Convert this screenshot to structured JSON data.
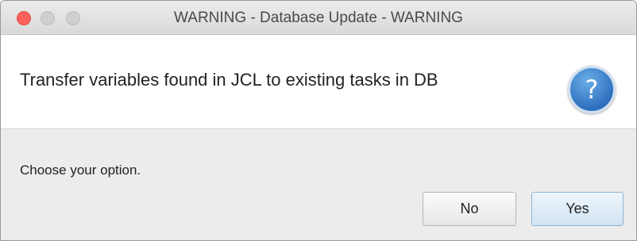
{
  "window": {
    "title": "WARNING - Database Update - WARNING"
  },
  "header": {
    "message": "Transfer variables found in JCL to existing tasks in DB",
    "icon": "question-icon",
    "icon_glyph": "?",
    "icon_color": "#2f6fbf"
  },
  "content": {
    "prompt": "Choose your option."
  },
  "buttons": {
    "no_label": "No",
    "yes_label": "Yes"
  }
}
